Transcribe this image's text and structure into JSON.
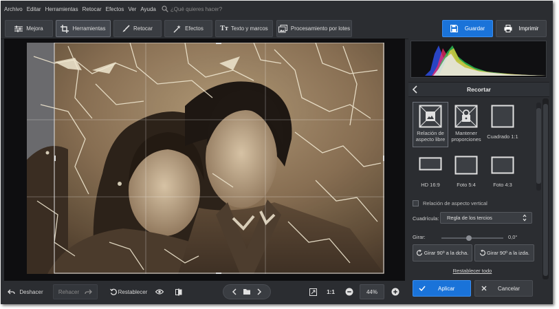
{
  "menu": {
    "items": [
      "Archivo",
      "Editar",
      "Herramientas",
      "Retocar",
      "Efectos",
      "Ver",
      "Ayuda"
    ],
    "search_placeholder": "¿Qué quieres hacer?"
  },
  "toolbar": {
    "tabs": [
      {
        "label": "Mejora",
        "icon": "sliders-icon"
      },
      {
        "label": "Herramientas",
        "icon": "crop-icon",
        "active": true
      },
      {
        "label": "Retocar",
        "icon": "brush-icon"
      },
      {
        "label": "Efectos",
        "icon": "magic-wand-icon"
      },
      {
        "label": "Texto y marcos",
        "icon": "text-icon"
      },
      {
        "label": "Procesamiento por lotes",
        "icon": "batch-icon"
      }
    ],
    "save_label": "Guardar",
    "print_label": "Imprimir",
    "accent": "#1a73d9"
  },
  "status": {
    "undo_label": "Deshacer",
    "redo_label": "Rehacer",
    "reset_label": "Restablecer",
    "ratio_label": "1:1",
    "zoom_value": "44%"
  },
  "panel": {
    "title": "Recortar",
    "ratios": [
      {
        "label": "Relación de aspecto libre",
        "icon": "free-ratio-icon",
        "selected": true
      },
      {
        "label": "Mantener proporciones",
        "icon": "lock-ratio-icon"
      },
      {
        "label": "Cuadrado 1:1",
        "icon": "square-icon"
      },
      {
        "label": "HD 16:9",
        "icon": "hd-icon"
      },
      {
        "label": "Foto 5:4",
        "icon": "photo-5-4-icon"
      },
      {
        "label": "Foto 4:3",
        "icon": "photo-4-3-icon"
      }
    ],
    "vertical_label": "Relación de aspecto vertical",
    "grid_label": "Cuadrícula:",
    "grid_value": "Regla de los tercios",
    "rotate_label": "Girar:",
    "rotate_value": "0,0°",
    "rotate_right": "Girar 90º a la dcha.",
    "rotate_left": "Girar 90º a la izda.",
    "reset_all": "Restablecer todo",
    "apply_label": "Aplicar",
    "cancel_label": "Cancelar"
  }
}
